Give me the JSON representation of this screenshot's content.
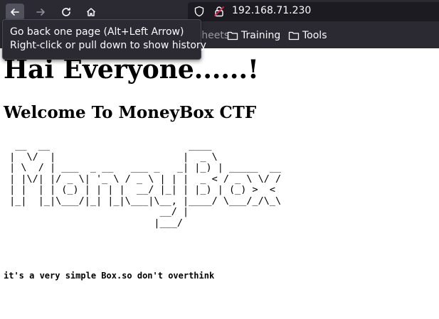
{
  "browser": {
    "url": "192.168.71.230",
    "tooltip": {
      "line1": "Go back one page (Alt+Left Arrow)",
      "line2": "Right-click or pull down to show history"
    },
    "bookmarks": {
      "partial_label": "heat sheets",
      "items": [
        "Training",
        "Tools"
      ]
    },
    "icons": [
      "back-arrow-icon",
      "forward-arrow-icon",
      "reload-icon",
      "home-icon",
      "shield-icon",
      "lock-icon",
      "folder-icon"
    ]
  },
  "page": {
    "heading": "Hai Everyone......!",
    "subheading": "Welcome To MoneyBox CTF",
    "ascii_art": "  __  __                        ____\n |  \\/  |                      |  _ \\\n | \\  / | ___  _ __   ___ _   _| |_) | _____  __\n | |\\/| |/ _ \\| '_ \\ / _ \\ | | |  _ < / _ \\ \\/ /\n | |  | | (_) | | | |  __/ |_| | |_) | (_) >  <\n |_|  |_|\\___/|_| |_|\\___|\\__, |____/ \\___/_/\\_\\\n                           __/ |\n                          |___/",
    "hint": "it's a very simple Box.so don't overthink"
  }
}
